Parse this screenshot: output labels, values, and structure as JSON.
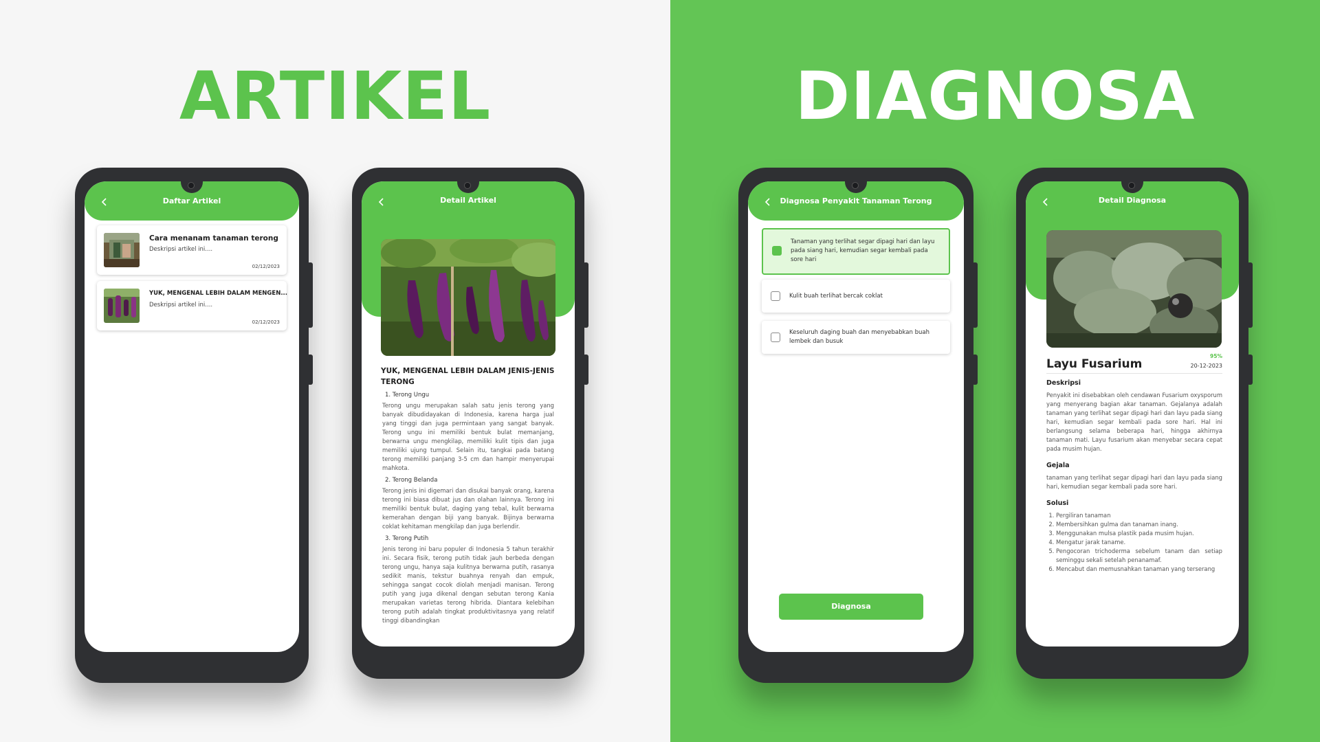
{
  "headings": {
    "left": "ARTIKEL",
    "right": "DIAGNOSA"
  },
  "phone1": {
    "title": "Daftar Artikel",
    "cards": [
      {
        "title": "Cara menanam tanaman terong",
        "desc": "Deskripsi artikel ini....",
        "date": "02/12/2023"
      },
      {
        "title": "YUK, MENGENAL LEBIH DALAM MENGEN...",
        "desc": "Deskripsi artikel ini....",
        "date": "02/12/2023"
      }
    ]
  },
  "phone2": {
    "title": "Detail Artikel",
    "article_title": "YUK, MENGENAL LEBIH DALAM JENIS-JENIS TERONG",
    "sections": [
      {
        "heading": "1. Terong Ungu",
        "body": "Terong ungu merupakan salah satu jenis terong yang banyak dibudidayakan di Indonesia, karena harga jual yang tinggi dan juga permintaan yang sangat banyak. Terong ungu ini memiliki bentuk bulat memanjang, berwarna ungu mengkilap, memiliki kulit tipis dan juga memiliki ujung tumpul. Selain itu, tangkai pada batang terong memiliki panjang 3-5 cm dan hampir menyerupai mahkota."
      },
      {
        "heading": "2. Terong Belanda",
        "body": "Terong jenis ini digemari dan disukai banyak orang, karena terong ini biasa dibuat jus dan olahan lainnya. Terong ini memiliki bentuk bulat, daging yang tebal, kulit berwarna kemerahan dengan biji yang banyak. Bijinya berwarna coklat kehitaman mengkilap dan juga berlendir."
      },
      {
        "heading": "3. Terong Putih",
        "body": "Jenis terong ini baru populer di Indonesia 5 tahun terakhir ini. Secara fisik, terong putih tidak jauh berbeda dengan terong ungu, hanya saja kulitnya berwarna putih, rasanya sedikit manis, tekstur buahnya renyah dan empuk, sehingga sangat cocok diolah menjadi manisan. Terong putih yang juga dikenal dengan sebutan terong Kania merupakan varietas terong hibrida. Diantara kelebihan terong putih adalah tingkat produktivitasnya yang relatif tinggi dibandingkan"
      }
    ]
  },
  "phone3": {
    "title": "Diagnosa Penyakit Tanaman Terong",
    "options": [
      {
        "text": "Tanaman yang terlihat segar dipagi hari dan layu pada siang hari, kemudian segar kembali pada sore hari",
        "selected": true
      },
      {
        "text": "Kulit buah terlihat bercak coklat",
        "selected": false
      },
      {
        "text": "Keseluruh daging buah dan menyebabkan buah lembek dan busuk",
        "selected": false
      }
    ],
    "button": "Diagnosa"
  },
  "phone4": {
    "title": "Detail Diagnosa",
    "disease": "Layu Fusarium",
    "confidence": "95%",
    "date": "20-12-2023",
    "desc_label": "Deskripsi",
    "desc": "Penyakit ini disebabkan oleh cendawan Fusarium oxysporum yang menyerang bagian akar tanaman. Gejalanya adalah tanaman yang terlihat segar dipagi hari dan layu pada siang hari, kemudian segar kembali pada sore hari. Hal ini berlangsung selama beberapa hari, hingga akhirnya tanaman mati. Layu fusarium akan menyebar secara cepat pada musim hujan.",
    "symptom_label": "Gejala",
    "symptom": "tanaman yang terlihat segar dipagi hari dan layu pada siang hari, kemudian segar kembali pada sore hari.",
    "solution_label": "Solusi",
    "solutions": [
      "Pergiliran tanaman",
      "Membersihkan gulma dan tanaman inang.",
      "Menggunakan mulsa plastik pada musim hujan.",
      "Mengatur jarak taname.",
      "Pengocoran trichoderma sebelum tanam dan setiap seminggu sekali setelah penanamaf.",
      "Mencabut dan memusnahkan tanaman yang terserang"
    ]
  },
  "colors": {
    "accent": "#5cc34d",
    "background_right": "#63c555",
    "phone_frame": "#2f3033"
  }
}
